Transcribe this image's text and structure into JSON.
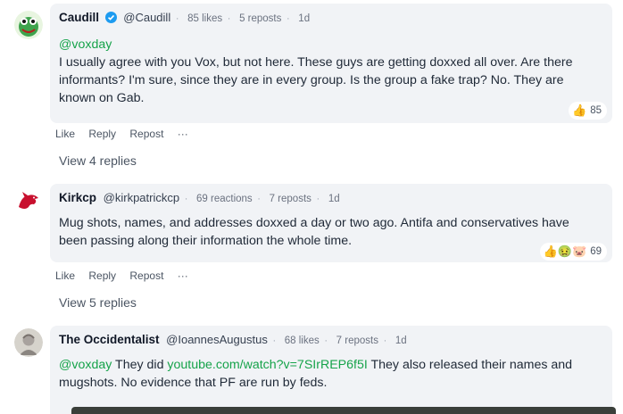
{
  "comments": [
    {
      "name": "Caudill",
      "verified": true,
      "handle": "@Caudill",
      "likes": "85 likes",
      "reposts": "5 reposts",
      "time": "1d",
      "mention": "@voxday",
      "text": "I usually agree with you Vox, but not here. These guys are getting doxxed all over. Are there informants? I'm sure, since they are in every group. Is the group a fake trap? No. They are known on Gab.",
      "reaction_emoji": "👍",
      "reaction_count": "85",
      "actions": [
        "Like",
        "Reply",
        "Repost",
        "···"
      ],
      "view_replies": "View 4 replies",
      "avatar_icon": "frog-icon"
    },
    {
      "name": "Kirkcp",
      "handle": "@kirkpatrickcp",
      "likes": "69 reactions",
      "reposts": "7 reposts",
      "time": "1d",
      "text": "Mug shots, names, and addresses doxxed a day or two ago. Antifa and conservatives have been passing along their information the whole time.",
      "reaction_emoji": "👍🤢🐷",
      "reaction_count": "69",
      "actions": [
        "Like",
        "Reply",
        "Repost",
        "···"
      ],
      "view_replies": "View 5 replies",
      "avatar_icon": "red-dragon-icon"
    },
    {
      "name": "The Occidentalist",
      "handle": "@IoannesAugustus",
      "likes": "68 likes",
      "reposts": "7 reposts",
      "time": "1d",
      "mention": "@voxday",
      "text_pre": "They did",
      "link": "youtube.com/watch?v=7SIrREP6f5I",
      "text_post": "They also released their names and mugshots. No evidence that PF are run by feds.",
      "avatar_icon": "statue-icon"
    }
  ],
  "colors": {
    "accent": "#16a34a",
    "bubble": "#f1f3f6",
    "verified": "#1d9bf0"
  }
}
